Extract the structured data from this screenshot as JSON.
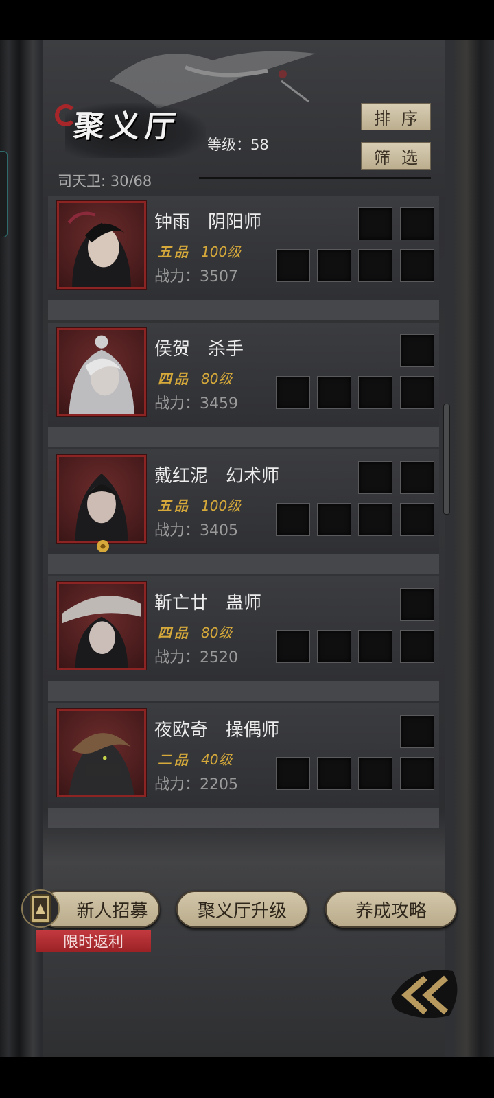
{
  "hall": {
    "title": "聚义厅",
    "level_text": "等级：58",
    "capacity_text": "司天卫: 30/68",
    "sort_label": "排序",
    "filter_label": "筛选"
  },
  "heroes": [
    {
      "name": "钟雨　阴阳师",
      "grade": "五品",
      "level": "100级",
      "power": "战力：3507",
      "top_slots": 2,
      "bottom_slots": 4
    },
    {
      "name": "侯贺　杀手",
      "grade": "四品",
      "level": "80级",
      "power": "战力：3459",
      "top_slots": 1,
      "bottom_slots": 4
    },
    {
      "name": "戴红泥　幻术师",
      "grade": "五品",
      "level": "100级",
      "power": "战力：3405",
      "top_slots": 2,
      "bottom_slots": 4
    },
    {
      "name": "靳亡廿　蛊师",
      "grade": "四品",
      "level": "80级",
      "power": "战力：2520",
      "top_slots": 1,
      "bottom_slots": 4
    },
    {
      "name": "夜欧奇　操偶师",
      "grade": "二品",
      "level": "40级",
      "power": "战力：2205",
      "top_slots": 1,
      "bottom_slots": 4
    }
  ],
  "actions": {
    "recruit_label": "新人招募",
    "upgrade_label": "聚义厅升级",
    "guide_label": "养成攻略",
    "promo_label": "限时返利"
  },
  "colors": {
    "accent_red": "#8c2424",
    "grade_gold": "#d6a93a",
    "button_parchment": "#d3c7aa"
  },
  "icons": {
    "back": "double-chevron-left-icon",
    "recruit": "recruit-token-icon"
  }
}
